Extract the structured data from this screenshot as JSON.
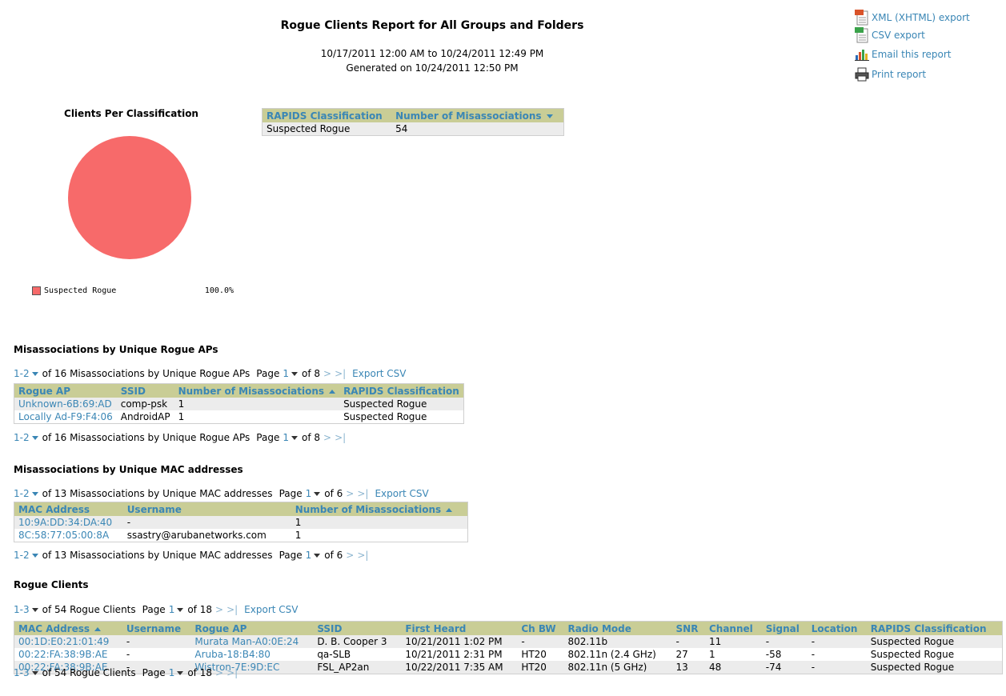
{
  "header": {
    "title": "Rogue Clients Report for All Groups and Folders",
    "date_range": "10/17/2011 12:00 AM to 10/24/2011 12:49 PM",
    "generated": "Generated on 10/24/2011 12:50 PM"
  },
  "exports": {
    "xml": "XML (XHTML) export",
    "csv": "CSV export",
    "email": "Email this report",
    "print": "Print report"
  },
  "chart_data": {
    "type": "pie",
    "title": "Clients Per Classification",
    "slices": [
      {
        "label": "Suspected Rogue",
        "value": 100.0,
        "color": "#f76a6a"
      }
    ],
    "legend": [
      {
        "label": "Suspected Rogue",
        "pct": "100.0%"
      }
    ]
  },
  "classification_table": {
    "headers": [
      "RAPIDS Classification",
      "Number of Misassociations"
    ],
    "rows": [
      [
        "Suspected Rogue",
        "54"
      ]
    ]
  },
  "rogue_aps": {
    "heading": "Misassociations by Unique Rogue APs",
    "pager_range": "1-2",
    "pager_text": "of 16 Misassociations by Unique Rogue APs",
    "page_label": "Page",
    "page_current": "1",
    "page_of": "of 8",
    "nav_next": ">",
    "nav_last": ">|",
    "export": "Export CSV",
    "headers": [
      "Rogue AP",
      "SSID",
      "Number of Misassociations",
      "RAPIDS Classification"
    ],
    "rows": [
      [
        "Unknown-6B:69:AD",
        "comp-psk",
        "1",
        "Suspected Rogue"
      ],
      [
        "Locally Ad-F9:F4:06",
        "AndroidAP",
        "1",
        "Suspected Rogue"
      ]
    ]
  },
  "mac_addresses": {
    "heading": "Misassociations by Unique MAC addresses",
    "pager_range": "1-2",
    "pager_text": "of 13 Misassociations by Unique MAC addresses",
    "page_label": "Page",
    "page_current": "1",
    "page_of": "of 6",
    "nav_next": ">",
    "nav_last": ">|",
    "export": "Export CSV",
    "headers": [
      "MAC Address",
      "Username",
      "Number of Misassociations"
    ],
    "rows": [
      [
        "10:9A:DD:34:DA:40",
        "-",
        "1"
      ],
      [
        "8C:58:77:05:00:8A",
        "ssastry@arubanetworks.com",
        "1"
      ]
    ]
  },
  "rogue_clients": {
    "heading": "Rogue Clients",
    "pager_range": "1-3",
    "pager_text": "of 54 Rogue Clients",
    "page_label": "Page",
    "page_current": "1",
    "page_of": "of 18",
    "nav_next": ">",
    "nav_last": ">|",
    "export": "Export CSV",
    "headers": [
      "MAC Address",
      "Username",
      "Rogue AP",
      "SSID",
      "First Heard",
      "Ch BW",
      "Radio Mode",
      "SNR",
      "Channel",
      "Signal",
      "Location",
      "RAPIDS Classification"
    ],
    "rows": [
      [
        "00:1D:E0:21:01:49",
        "-",
        "Murata Man-A0:0E:24",
        "D. B. Cooper 3",
        "10/21/2011 1:02 PM",
        "-",
        "802.11b",
        "-",
        "11",
        "-",
        "-",
        "Suspected Rogue"
      ],
      [
        "00:22:FA:38:9B:AE",
        "-",
        "Aruba-18:B4:80",
        "qa-SLB",
        "10/21/2011 2:31 PM",
        "HT20",
        "802.11n (2.4 GHz)",
        "27",
        "1",
        "-58",
        "-",
        "Suspected Rogue"
      ],
      [
        "00:22:FA:38:9B:AE",
        "-",
        "Wistron-7E:9D:EC",
        "FSL_AP2an",
        "10/22/2011 7:35 AM",
        "HT20",
        "802.11n (5 GHz)",
        "13",
        "48",
        "-74",
        "-",
        "Suspected Rogue"
      ]
    ]
  },
  "colors": {
    "header_bg": "#c9cd96",
    "link": "#3a86b5",
    "pie": "#f76a6a"
  }
}
